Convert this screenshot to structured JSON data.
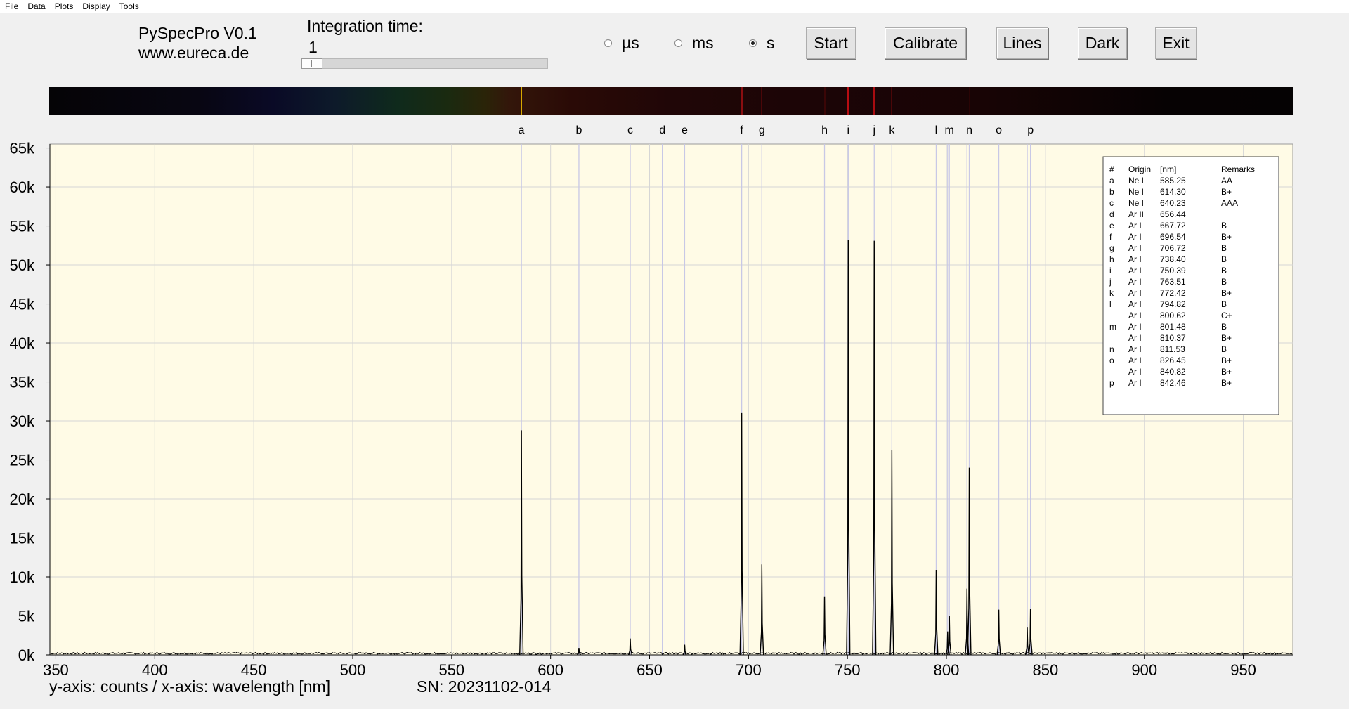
{
  "menu": [
    "File",
    "Data",
    "Plots",
    "Display",
    "Tools"
  ],
  "app": {
    "title": "PySpecPro V0.1",
    "url": "www.eureca.de"
  },
  "integration": {
    "label": "Integration time:",
    "value": "1",
    "slider_fraction": 0.0
  },
  "units": [
    {
      "label": "µs",
      "selected": false
    },
    {
      "label": "ms",
      "selected": false
    },
    {
      "label": "s",
      "selected": true
    }
  ],
  "buttons": {
    "start": "Start",
    "calibrate": "Calibrate",
    "lines": "Lines",
    "dark": "Dark",
    "exit": "Exit"
  },
  "colors": {
    "plot_background": "#fffbe6",
    "marker_line": "#c8c8e6",
    "trace": "#000000",
    "sodium_line": "#e0b000",
    "neon_line": "#c01010"
  },
  "spectrum_band_lines": [
    {
      "wavelength": 585.25,
      "color": "#d8a800"
    },
    {
      "wavelength": 696.54,
      "color": "#8a0e10"
    },
    {
      "wavelength": 706.72,
      "color": "#4a0708"
    },
    {
      "wavelength": 738.4,
      "color": "#3a0606"
    },
    {
      "wavelength": 750.39,
      "color": "#b80d12"
    },
    {
      "wavelength": 763.51,
      "color": "#a80c10"
    },
    {
      "wavelength": 772.42,
      "color": "#4a0708"
    },
    {
      "wavelength": 811.53,
      "color": "#2a0405"
    }
  ],
  "chart_data": {
    "type": "line",
    "xlabel": "wavelength [nm]",
    "ylabel": "counts",
    "xlim": [
      347,
      975
    ],
    "ylim": [
      0,
      65500
    ],
    "xticks": [
      350,
      400,
      450,
      500,
      550,
      600,
      650,
      700,
      750,
      800,
      850,
      900,
      950
    ],
    "yticks": [
      0,
      5000,
      10000,
      15000,
      20000,
      25000,
      30000,
      35000,
      40000,
      45000,
      50000,
      55000,
      60000,
      65000
    ],
    "ytick_labels": [
      "0k",
      "5k",
      "10k",
      "15k",
      "20k",
      "25k",
      "30k",
      "35k",
      "40k",
      "45k",
      "50k",
      "55k",
      "60k",
      "65k"
    ],
    "grid": true,
    "caption": "y-axis: counts / x-axis: wavelength [nm]",
    "serial": "SN: 20231102-014",
    "markers": [
      {
        "letter": "a",
        "x": 585.25
      },
      {
        "letter": "b",
        "x": 614.3
      },
      {
        "letter": "c",
        "x": 640.23
      },
      {
        "letter": "d",
        "x": 656.44
      },
      {
        "letter": "e",
        "x": 667.72
      },
      {
        "letter": "f",
        "x": 696.54
      },
      {
        "letter": "g",
        "x": 706.72
      },
      {
        "letter": "h",
        "x": 738.4
      },
      {
        "letter": "i",
        "x": 750.39
      },
      {
        "letter": "j",
        "x": 763.51
      },
      {
        "letter": "k",
        "x": 772.42
      },
      {
        "letter": "l",
        "x": 794.82
      },
      {
        "letter": "",
        "x": 800.62
      },
      {
        "letter": "m",
        "x": 801.48
      },
      {
        "letter": "",
        "x": 810.37
      },
      {
        "letter": "n",
        "x": 811.53
      },
      {
        "letter": "o",
        "x": 826.45
      },
      {
        "letter": "",
        "x": 840.82
      },
      {
        "letter": "p",
        "x": 842.46
      }
    ],
    "peaks": [
      {
        "x": 585.25,
        "y": 28800
      },
      {
        "x": 614.3,
        "y": 900
      },
      {
        "x": 640.23,
        "y": 2100
      },
      {
        "x": 667.72,
        "y": 1300
      },
      {
        "x": 696.54,
        "y": 31000
      },
      {
        "x": 706.72,
        "y": 11600
      },
      {
        "x": 738.4,
        "y": 7500
      },
      {
        "x": 750.39,
        "y": 53200
      },
      {
        "x": 763.51,
        "y": 53100
      },
      {
        "x": 772.42,
        "y": 26300
      },
      {
        "x": 794.82,
        "y": 10900
      },
      {
        "x": 800.62,
        "y": 3000
      },
      {
        "x": 801.48,
        "y": 5000
      },
      {
        "x": 810.37,
        "y": 8500
      },
      {
        "x": 811.53,
        "y": 24000
      },
      {
        "x": 826.45,
        "y": 5800
      },
      {
        "x": 840.82,
        "y": 3500
      },
      {
        "x": 842.46,
        "y": 5900
      }
    ],
    "line_table": {
      "headers": [
        "#",
        "Origin",
        "[nm]",
        "Remarks"
      ],
      "rows": [
        [
          "a",
          "Ne I",
          "585.25",
          "AA"
        ],
        [
          "b",
          "Ne I",
          "614.30",
          "B+"
        ],
        [
          "c",
          "Ne I",
          "640.23",
          "AAA"
        ],
        [
          "d",
          "Ar II",
          "656.44",
          ""
        ],
        [
          "e",
          "Ar I",
          "667.72",
          "B"
        ],
        [
          "f",
          "Ar I",
          "696.54",
          "B+"
        ],
        [
          "g",
          "Ar I",
          "706.72",
          "B"
        ],
        [
          "h",
          "Ar I",
          "738.40",
          "B"
        ],
        [
          "i",
          "Ar I",
          "750.39",
          "B"
        ],
        [
          "j",
          "Ar I",
          "763.51",
          "B"
        ],
        [
          "k",
          "Ar I",
          "772.42",
          "B+"
        ],
        [
          "l",
          "Ar I",
          "794.82",
          "B"
        ],
        [
          "",
          "Ar I",
          "800.62",
          "C+"
        ],
        [
          "m",
          "Ar I",
          "801.48",
          "B"
        ],
        [
          "",
          "Ar I",
          "810.37",
          "B+"
        ],
        [
          "n",
          "Ar I",
          "811.53",
          "B"
        ],
        [
          "o",
          "Ar I",
          "826.45",
          "B+"
        ],
        [
          "",
          "Ar I",
          "840.82",
          "B+"
        ],
        [
          "p",
          "Ar I",
          "842.46",
          "B+"
        ]
      ]
    }
  }
}
